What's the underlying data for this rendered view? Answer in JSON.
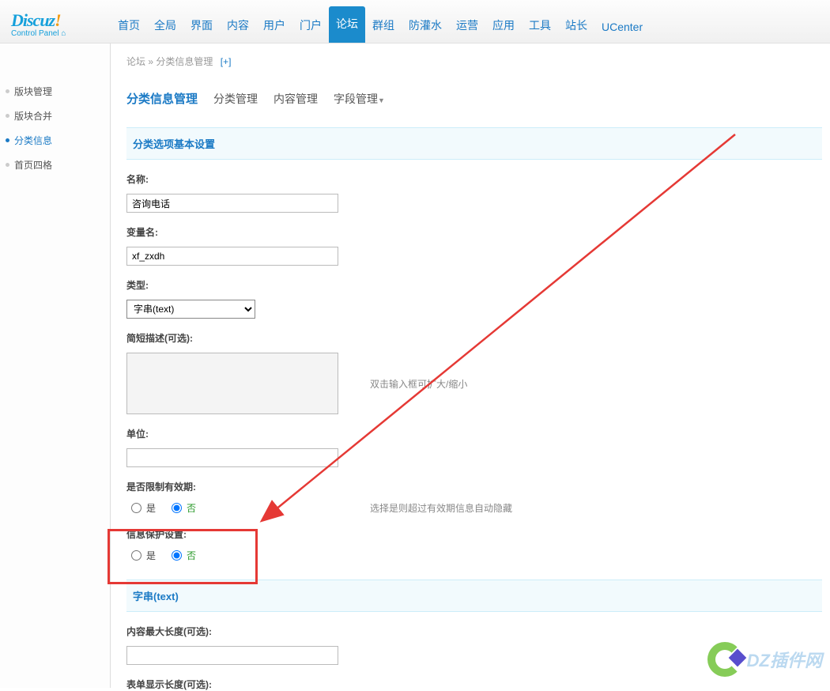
{
  "logo": {
    "main_pre": "Discuz",
    "main_ex": "!",
    "sub": "Control Panel",
    "home_glyph": "⌂"
  },
  "topnav": [
    {
      "label": "首页"
    },
    {
      "label": "全局"
    },
    {
      "label": "界面"
    },
    {
      "label": "内容"
    },
    {
      "label": "用户"
    },
    {
      "label": "门户"
    },
    {
      "label": "论坛",
      "active": true
    },
    {
      "label": "群组"
    },
    {
      "label": "防灌水"
    },
    {
      "label": "运营"
    },
    {
      "label": "应用"
    },
    {
      "label": "工具"
    },
    {
      "label": "站长"
    },
    {
      "label": "UCenter"
    }
  ],
  "sidebar": [
    {
      "label": "版块管理"
    },
    {
      "label": "版块合并"
    },
    {
      "label": "分类信息",
      "active": true
    },
    {
      "label": "首页四格"
    }
  ],
  "breadcrumb": {
    "root": "论坛",
    "sep": "»",
    "current": "分类信息管理",
    "plus": "[+]"
  },
  "tabs": {
    "current": "分类信息管理",
    "items": [
      "分类管理",
      "内容管理",
      "字段管理"
    ],
    "caret": "▼"
  },
  "section1_title": "分类选项基本设置",
  "fields": {
    "name": {
      "label": "名称:",
      "value": "咨询电话"
    },
    "varname": {
      "label": "变量名:",
      "value": "xf_zxdh"
    },
    "type": {
      "label": "类型:",
      "value": "字串(text)"
    },
    "desc": {
      "label": "简短描述(可选):",
      "hint": "双击输入框可扩大/缩小"
    },
    "unit": {
      "label": "单位:",
      "value": ""
    },
    "expire": {
      "label": "是否限制有效期:",
      "yes": "是",
      "no": "否",
      "hint": "选择是则超过有效期信息自动隐藏"
    },
    "protect": {
      "label": "信息保护设置:",
      "yes": "是",
      "no": "否"
    }
  },
  "section2_title": "字串(text)",
  "fields2": {
    "maxlen": {
      "label": "内容最大长度(可选):",
      "value": ""
    },
    "displen": {
      "label": "表单显示长度(可选):"
    }
  },
  "watermark_text": "DZ插件网"
}
